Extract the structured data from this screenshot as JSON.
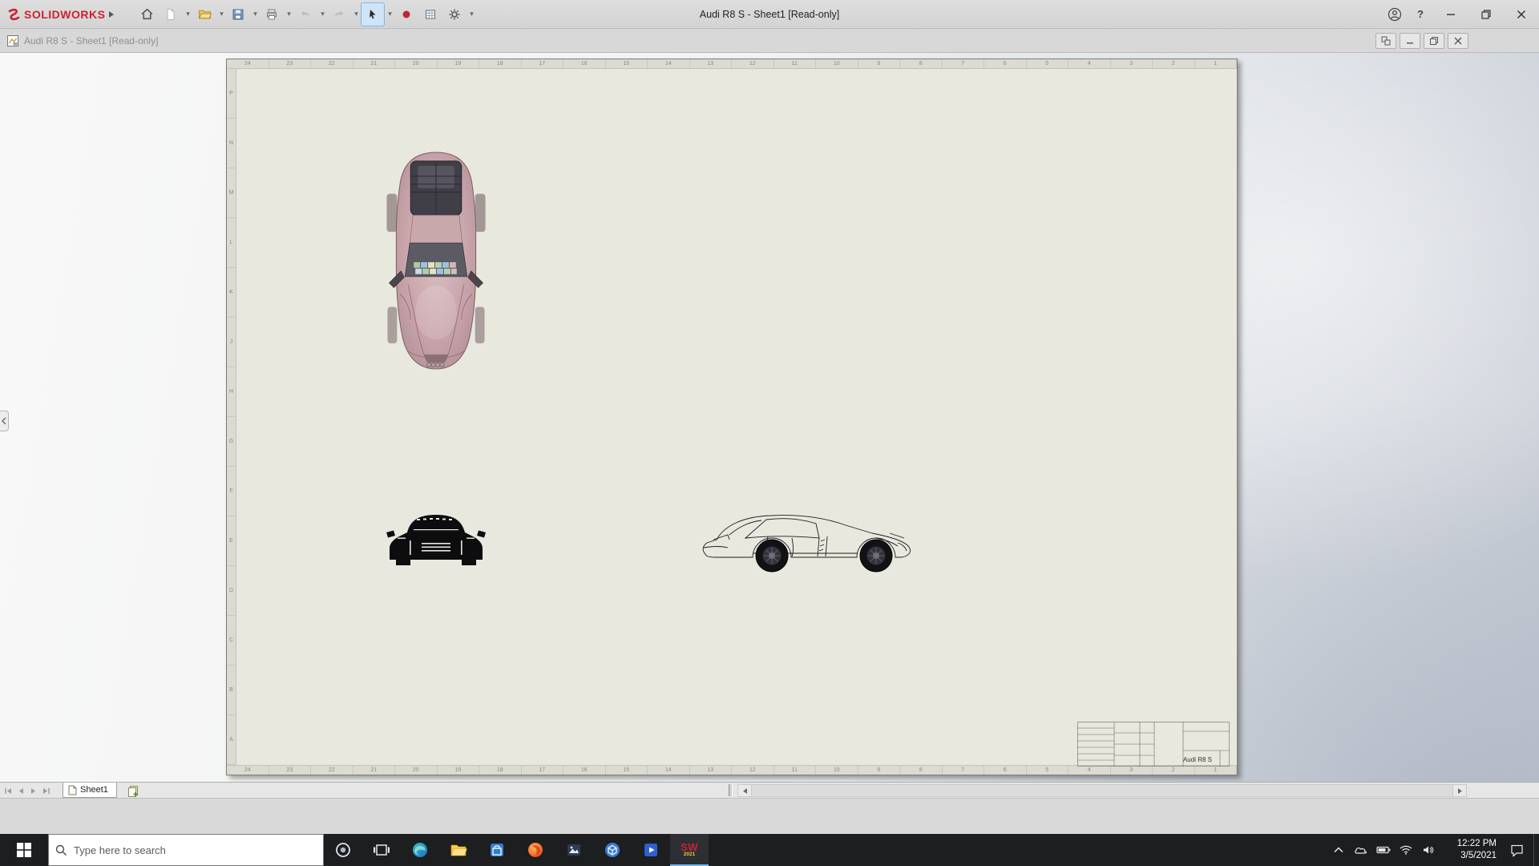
{
  "app": {
    "brand": "SOLIDWORKS",
    "title": "Audi R8 S - Sheet1 [Read-only]"
  },
  "doc_window": {
    "title": "Audi R8 S - Sheet1 [Read-only]"
  },
  "icons": {
    "caret": "▾",
    "help": "?"
  },
  "sheet": {
    "tab_label": "Sheet1",
    "ruler_top": [
      "24",
      "23",
      "22",
      "21",
      "20",
      "19",
      "18",
      "17",
      "16",
      "15",
      "14",
      "13",
      "12",
      "11",
      "10",
      "9",
      "8",
      "7",
      "6",
      "5",
      "4",
      "3",
      "2",
      "1"
    ],
    "ruler_left": [
      "P",
      "N",
      "M",
      "L",
      "K",
      "J",
      "H",
      "G",
      "F",
      "E",
      "D",
      "C",
      "B",
      "A"
    ],
    "title_block": {
      "name": "Audi R8 S"
    }
  },
  "taskbar": {
    "search_placeholder": "Type here to search",
    "sw_icon_text": "SW",
    "sw_icon_year": "2021",
    "clock": {
      "time": "12:22 PM",
      "date": "3/5/2021"
    }
  }
}
